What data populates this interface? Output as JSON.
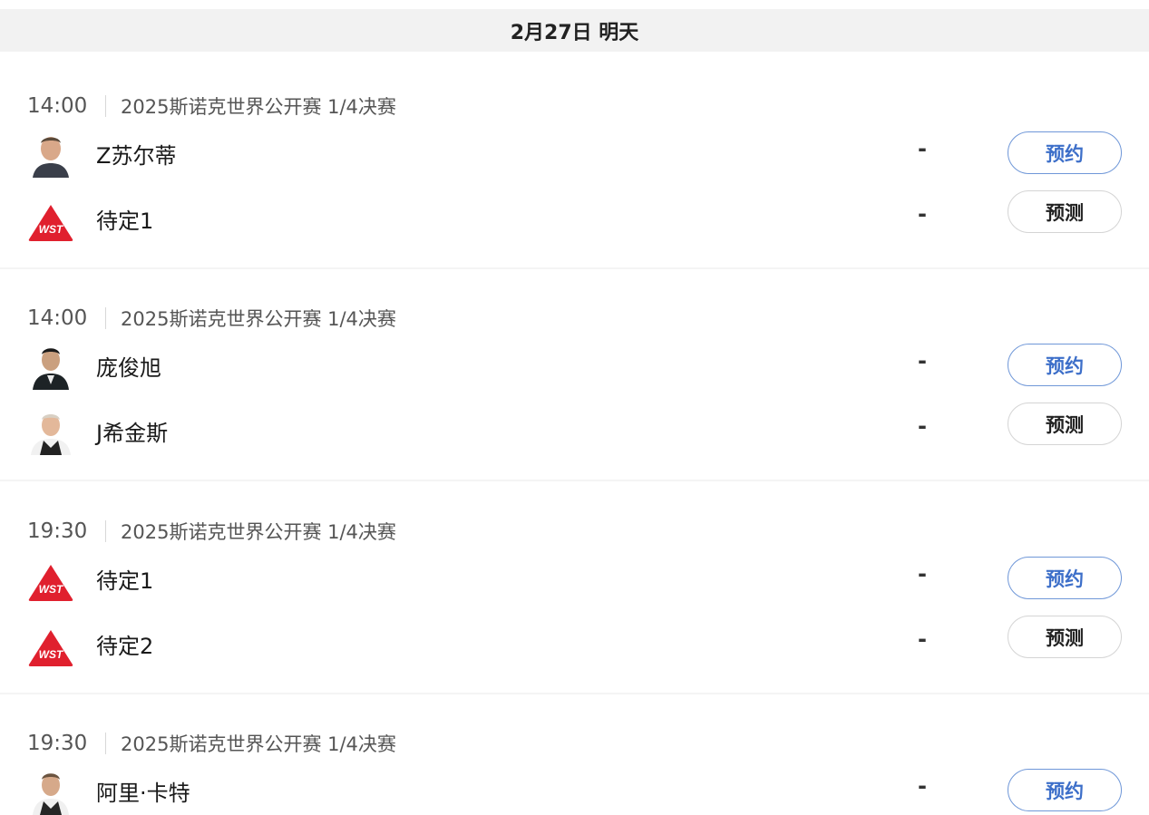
{
  "date_header": "2月27日 明天",
  "matches": [
    {
      "time": "14:00",
      "event": "2025斯诺克世界公开赛 1/4决赛",
      "players": [
        {
          "name": "Z苏尔蒂",
          "score": "-",
          "avatar": "player-photo-icon"
        },
        {
          "name": "待定1",
          "score": "-",
          "avatar": "wst-logo-icon"
        }
      ],
      "buttons": {
        "reserve": "预约",
        "predict": "预测"
      }
    },
    {
      "time": "14:00",
      "event": "2025斯诺克世界公开赛 1/4决赛",
      "players": [
        {
          "name": "庞俊旭",
          "score": "-",
          "avatar": "player-photo-icon"
        },
        {
          "name": "J希金斯",
          "score": "-",
          "avatar": "player-photo-icon"
        }
      ],
      "buttons": {
        "reserve": "预约",
        "predict": "预测"
      }
    },
    {
      "time": "19:30",
      "event": "2025斯诺克世界公开赛 1/4决赛",
      "players": [
        {
          "name": "待定1",
          "score": "-",
          "avatar": "wst-logo-icon"
        },
        {
          "name": "待定2",
          "score": "-",
          "avatar": "wst-logo-icon"
        }
      ],
      "buttons": {
        "reserve": "预约",
        "predict": "预测"
      }
    },
    {
      "time": "19:30",
      "event": "2025斯诺克世界公开赛 1/4决赛",
      "players": [
        {
          "name": "阿里·卡特",
          "score": "-",
          "avatar": "player-photo-icon"
        }
      ],
      "buttons": {
        "reserve": "预约"
      }
    }
  ],
  "colors": {
    "header_bg": "#f2f2f2",
    "reserve_accent": "#3d6fc9",
    "wst_red": "#e0202e"
  }
}
